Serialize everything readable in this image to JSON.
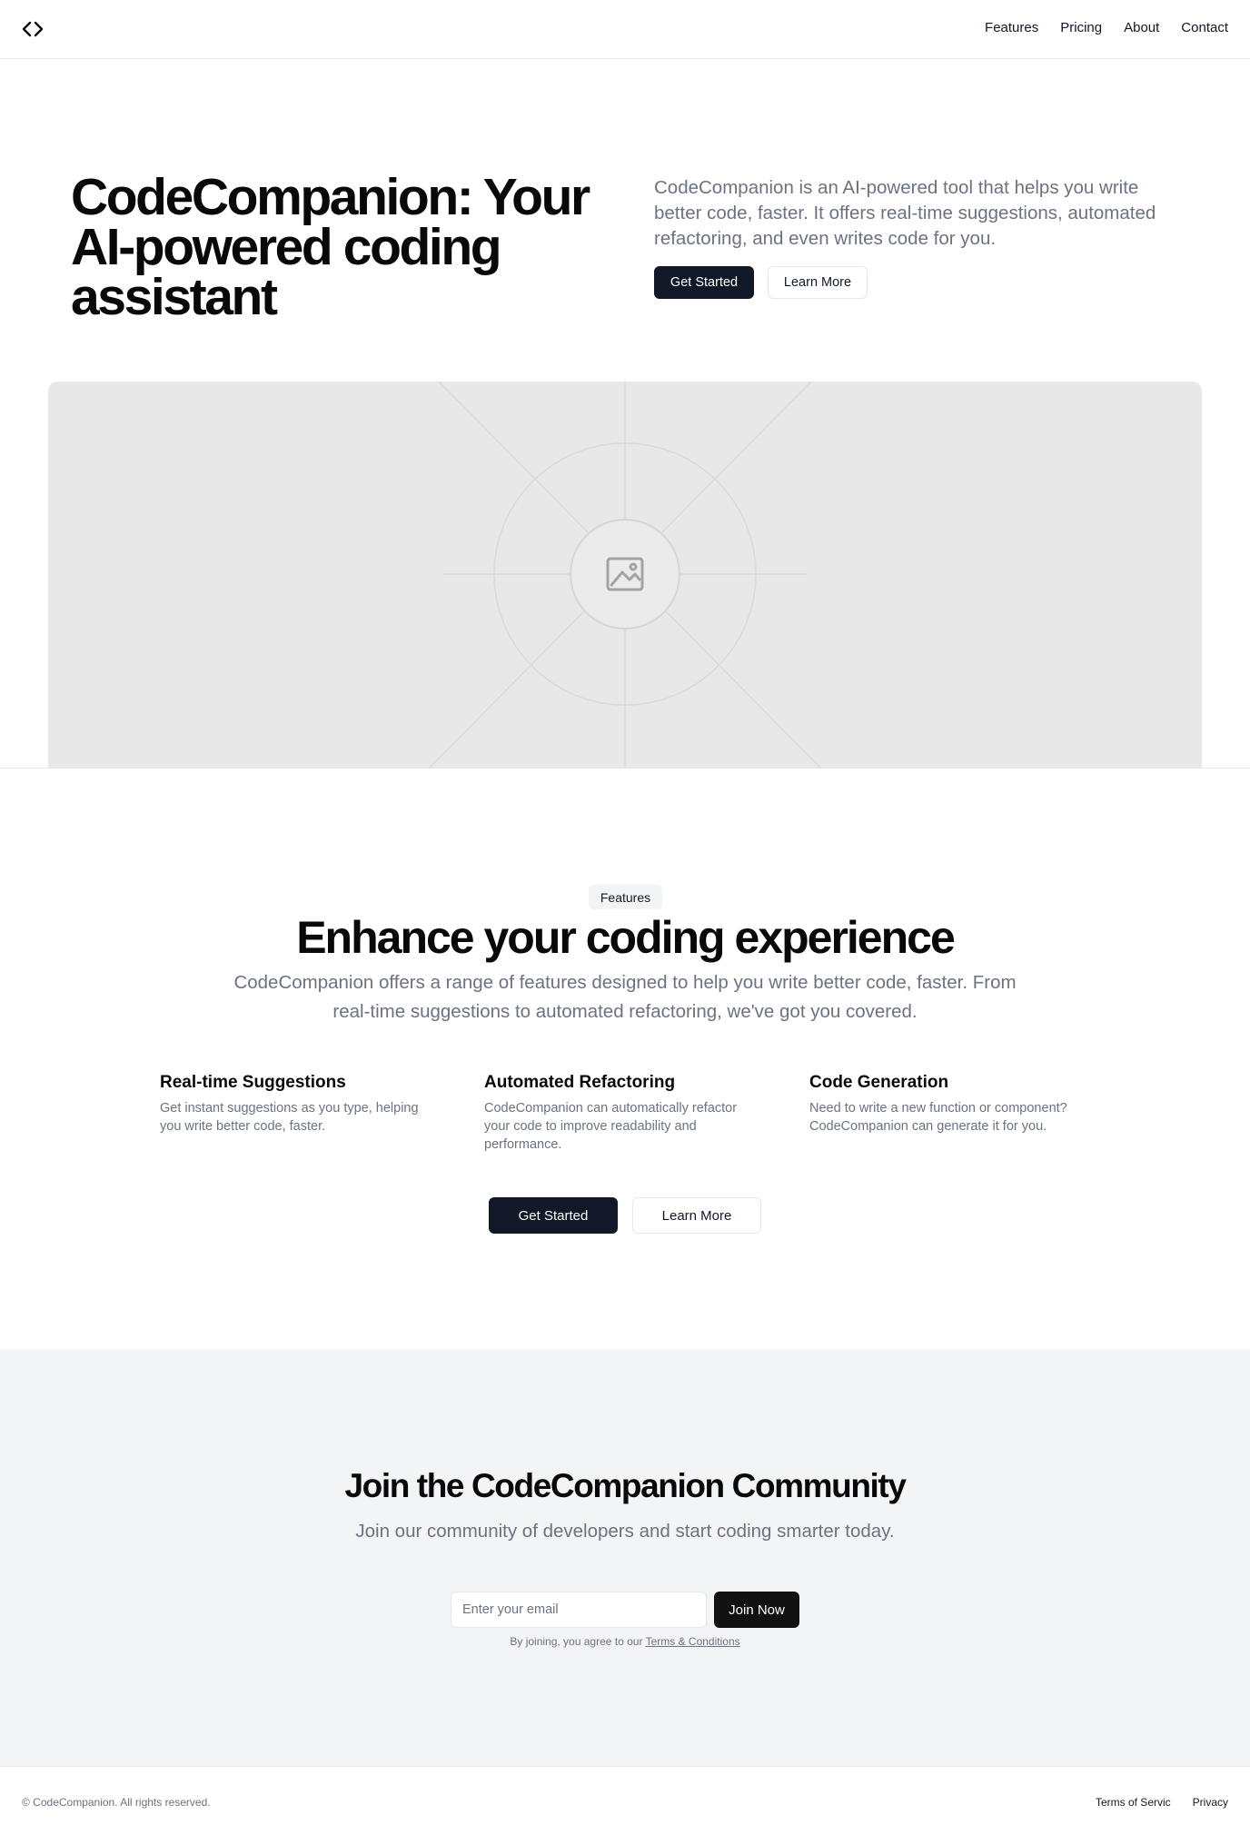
{
  "header": {
    "logo_icon": "code-brackets-icon",
    "nav": [
      "Features",
      "Pricing",
      "About",
      "Contact"
    ]
  },
  "hero": {
    "title": "CodeCompanion: Your AI-powered coding assistant",
    "description": "CodeCompanion is an AI-powered tool that helps you write better code, faster. It offers real-time suggestions, automated refactoring, and even writes code for you.",
    "primary_button": "Get Started",
    "secondary_button": "Learn More",
    "image_icon": "image-placeholder-icon"
  },
  "features": {
    "badge": "Features",
    "title": "Enhance your coding experience",
    "description": "CodeCompanion offers a range of features designed to help you write better code, faster. From real-time suggestions to automated refactoring, we've got you covered.",
    "items": [
      {
        "title": "Real-time Suggestions",
        "text": "Get instant suggestions as you type, helping you write better code, faster."
      },
      {
        "title": "Automated Refactoring",
        "text": "CodeCompanion can automatically refactor your code to improve readability and performance."
      },
      {
        "title": "Code Generation",
        "text": "Need to write a new function or component? CodeCompanion can generate it for you."
      }
    ],
    "primary_button": "Get Started",
    "secondary_button": "Learn More"
  },
  "community": {
    "title": "Join the CodeCompanion Community",
    "description": "Join our community of developers and start coding smarter today.",
    "email_placeholder": "Enter your email",
    "join_button": "Join Now",
    "terms_prefix": "By joining, you agree to our",
    "terms_link": "Terms & Conditions"
  },
  "footer": {
    "copyright": "© CodeCompanion. All rights reserved.",
    "links": [
      "Terms of Servic",
      "Privacy"
    ]
  },
  "colors": {
    "primary": "#111827",
    "muted_text": "#6b7280",
    "section_bg": "#f3f4f6",
    "placeholder_bg": "#e8e8e8"
  }
}
